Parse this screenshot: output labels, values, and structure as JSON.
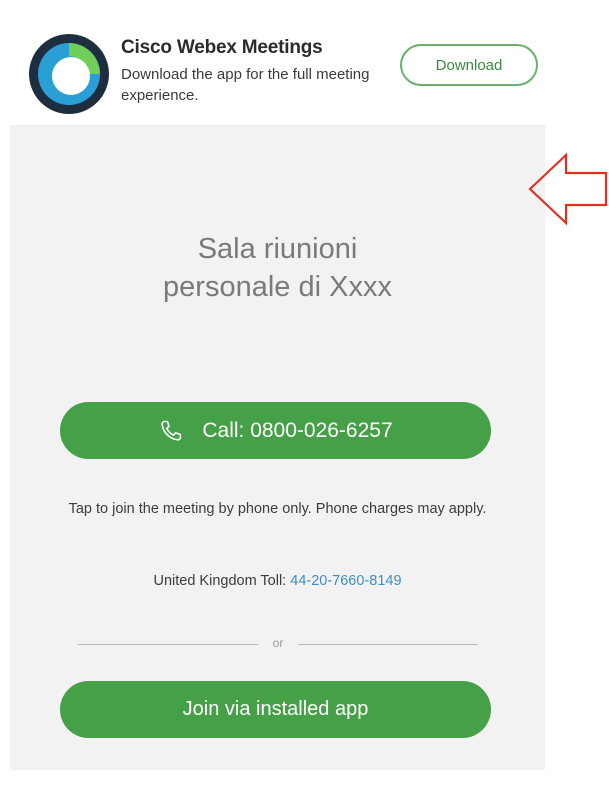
{
  "banner": {
    "app_name": "Cisco Webex Meetings",
    "description": "Download the app for the full meeting experience.",
    "download_label": "Download",
    "logo_icon": "webex-logo-icon"
  },
  "meeting": {
    "room_title_line1": "Sala riunioni",
    "room_title_line2": "personale di Xxxx",
    "call_label": "Call: 0800-026-6257",
    "call_icon": "phone-icon",
    "info_text": "Tap to join the meeting by phone only. Phone charges may apply.",
    "toll_label": "United Kingdom Toll:",
    "toll_number": "44-20-7660-8149",
    "divider_text": "or",
    "join_label": "Join via installed app"
  },
  "annotation": {
    "icon": "left-arrow-icon",
    "color": "#e03020"
  },
  "colors": {
    "accent_green": "#45a047",
    "link_blue": "#3b8fc4",
    "panel_gray": "#f2f2f2"
  }
}
